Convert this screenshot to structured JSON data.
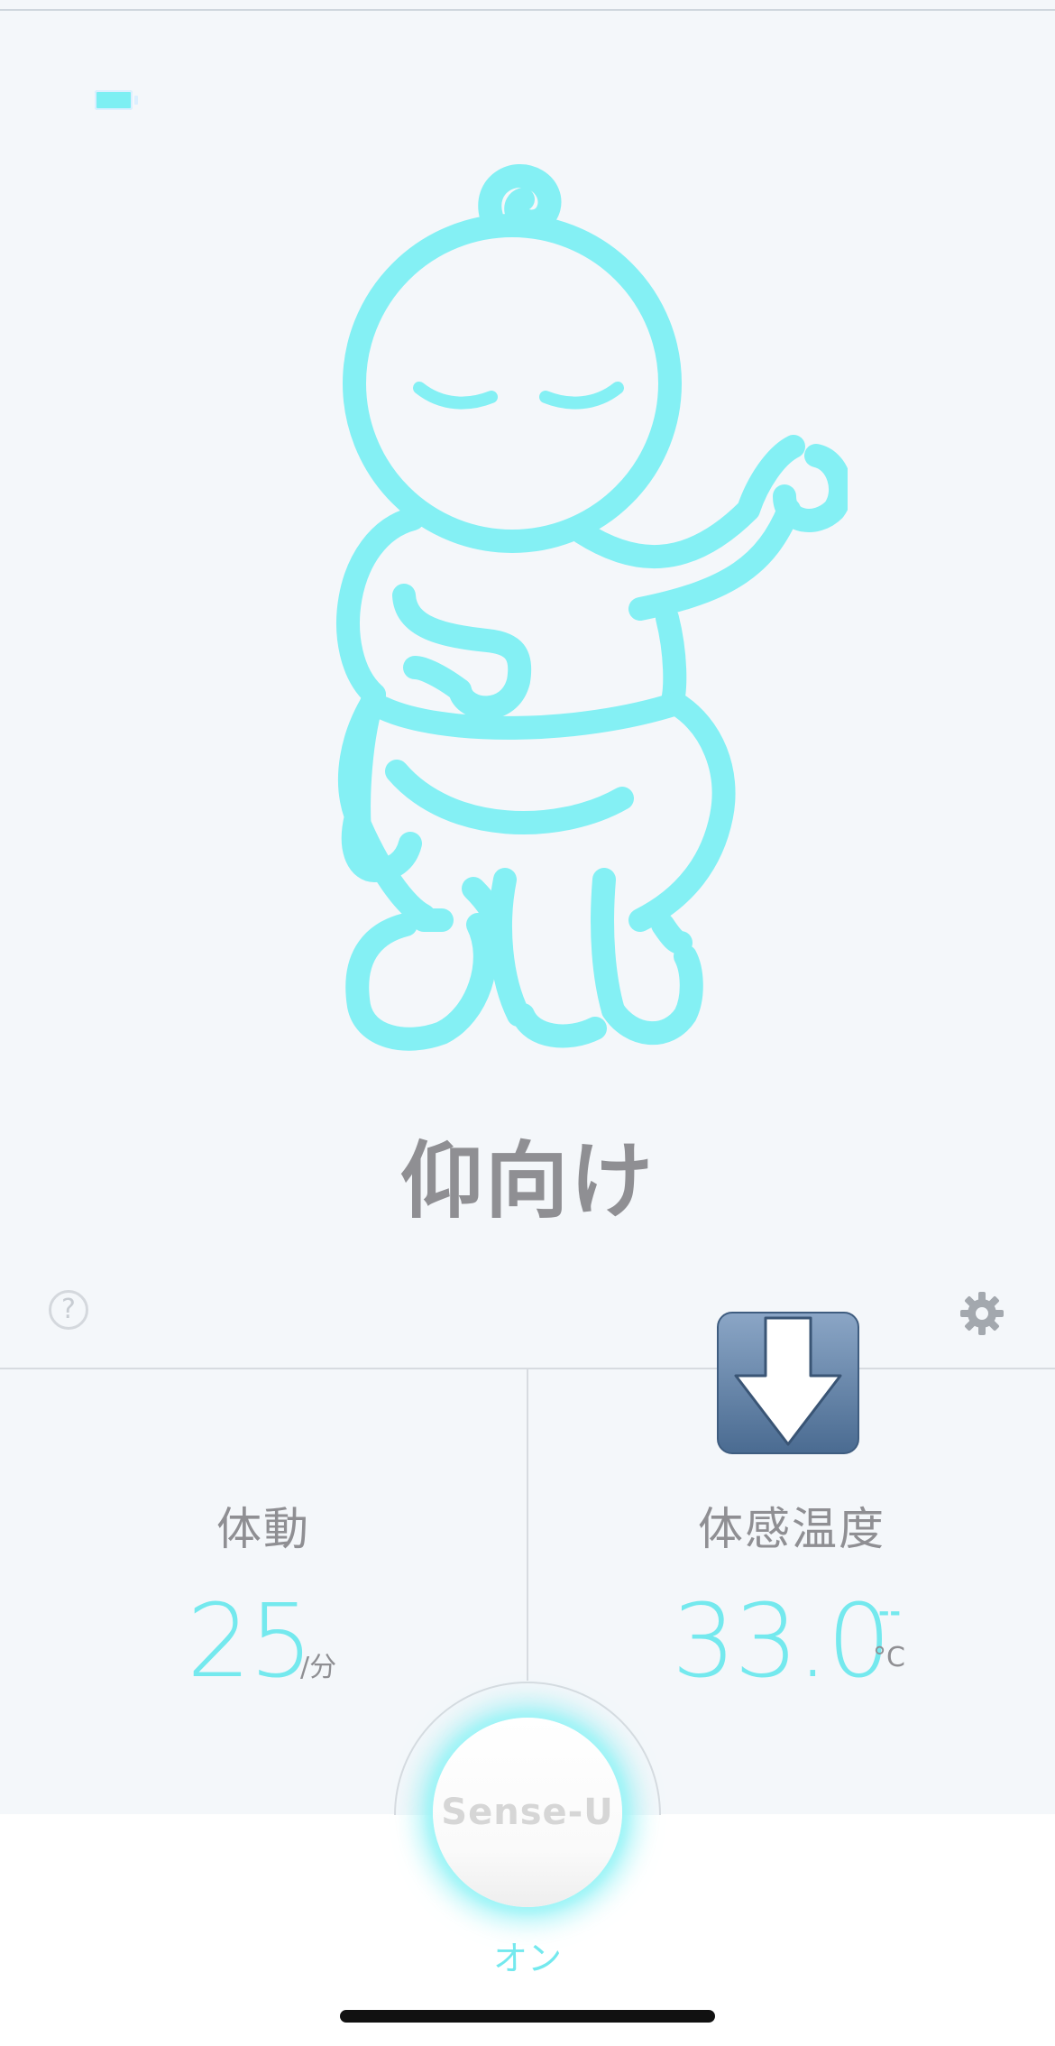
{
  "status": {
    "battery_icon": "battery-icon",
    "battery_color": "#7deff3"
  },
  "main": {
    "posture": "仰向け",
    "illustration_icon": "baby-sleeping-icon",
    "accent_color": "#74e9ee"
  },
  "toolbar": {
    "help_icon": "question-circle-icon",
    "help_glyph": "?",
    "settings_icon": "gear-icon"
  },
  "metrics": {
    "movement": {
      "label": "体動",
      "value": "25",
      "unit": "/分"
    },
    "temperature": {
      "label": "体感温度",
      "value": "33.0",
      "trend": "--",
      "unit": "°C"
    }
  },
  "overlay": {
    "download_icon": "download-arrow-icon"
  },
  "device_button": {
    "label": "Sense-U",
    "state": "オン"
  }
}
